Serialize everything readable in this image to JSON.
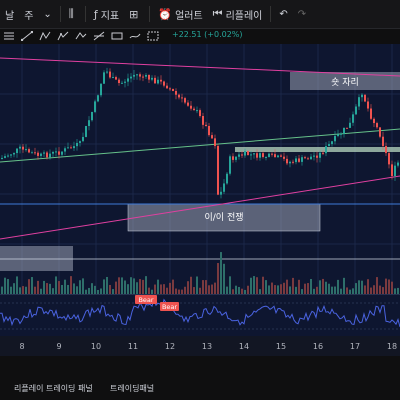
{
  "toolbar": {
    "timeframe_1": "날",
    "timeframe_2": "주",
    "indicators_label": "지표",
    "alert_label": "얼러트",
    "replay_label": "리플레이"
  },
  "drawing_tools": [
    "text-icon",
    "line-tool-icon",
    "pitchfork-icon",
    "fib-icon",
    "pattern-icon",
    "projection-icon",
    "measure-icon",
    "brush-icon",
    "ruler-icon",
    "zoom-icon",
    "magnet-icon",
    "lock-icon",
    "visibility-icon",
    "select-icon",
    "trash-icon"
  ],
  "price_change": "+22.51 (+0.02%)",
  "zones": {
    "resistance_label": "숏 자리",
    "trade_label": "이/이 전쟁"
  },
  "oscillator": {
    "bear_label_1": "Bear",
    "bear_label_2": "Bear"
  },
  "x_axis": [
    "8",
    "9",
    "10",
    "11",
    "12",
    "13",
    "14",
    "15",
    "16",
    "17",
    "18"
  ],
  "bottom_tabs": {
    "tab1": "리플레이 트레이딩 패널",
    "tab2": "트레이딩패널"
  },
  "colors": {
    "chart_bg": "#0e1630",
    "up": "#26a69a",
    "down": "#ef5350",
    "trendline_pink": "#e040a0",
    "trendline_green": "#66c28a",
    "oscillator": "#4a63e0",
    "zone_fill": "#9aa3b5"
  }
}
